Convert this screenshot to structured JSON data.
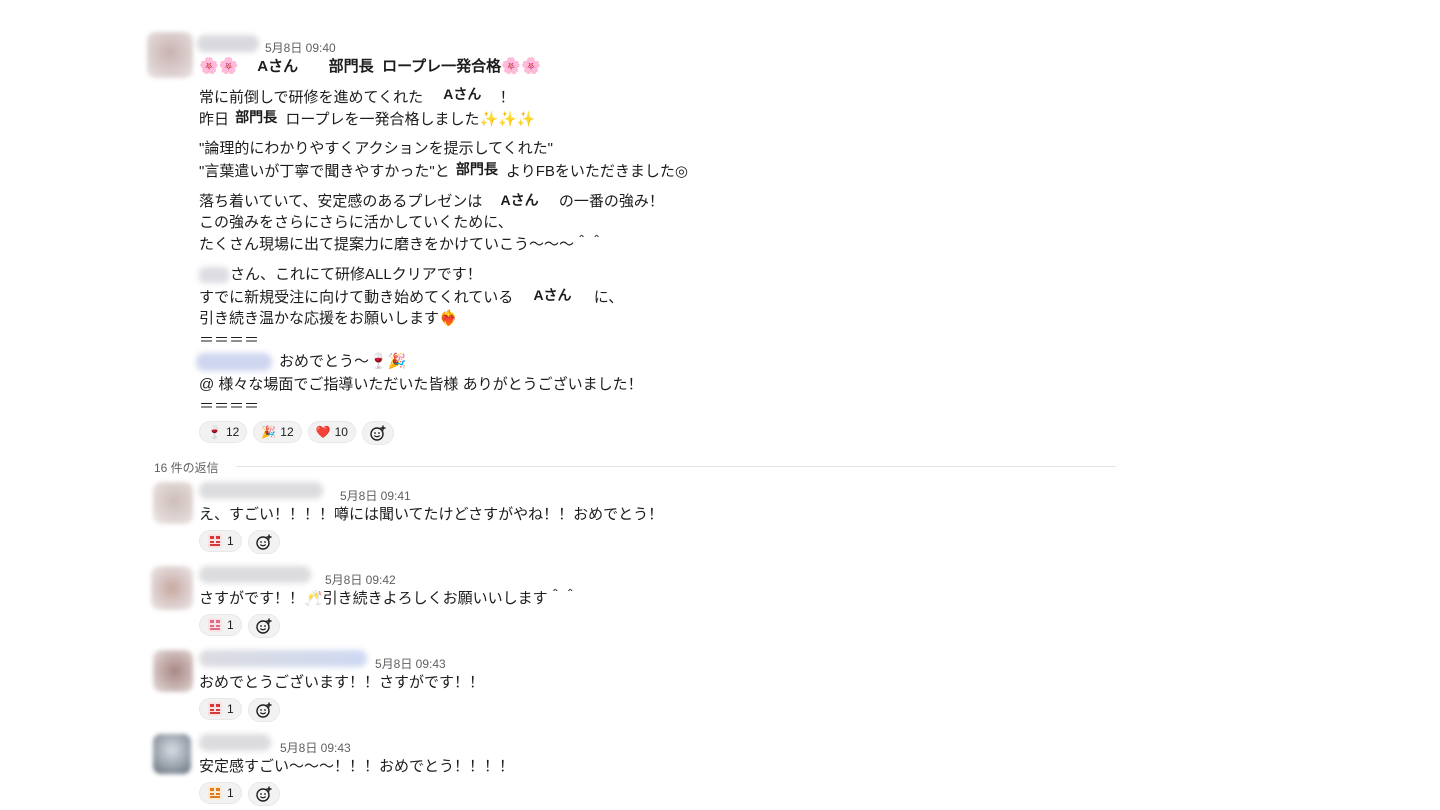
{
  "message": {
    "timestamp": "5月8日 09:40",
    "title_parts": [
      "🌸🌸",
      "Aさん",
      "部門長",
      "ロープレ一発合格",
      "🌸🌸"
    ],
    "lines": {
      "l1a": "常に前倒しで研修を進めてくれた",
      "l1b": "Aさん",
      "l1c": "！",
      "l2a": "昨日",
      "l2b": "部門長",
      "l2c": "ロープレを一発合格しました✨✨✨",
      "l3": "\"論理的にわかりやすくアクションを提示してくれた\"",
      "l4a": "\"言葉遣いが丁寧で聞きやすかった\"と",
      "l4b": "部門長",
      "l4c": "よりFBをいただきました◎",
      "l5a": "落ち着いていて、安定感のあるプレゼンは",
      "l5b": "Aさん",
      "l5c": "の一番の強み！",
      "l6": "この強みをさらにさらに活かしていくために、",
      "l7": "たくさん現場に出て提案力に磨きをかけていこう〜〜〜＾＾",
      "l8": "さん、これにて研修ALLクリアです！",
      "l9a": "すでに新規受注に向けて動き始めてくれている",
      "l9b": "Aさん",
      "l9c": "に、",
      "l10": "引き続き温かな応援をお願いします❤️‍🔥",
      "l11": "＝＝＝＝",
      "l12": "おめでとう〜🍷🎉",
      "l13": "@ 様々な場面でご指導いただいた皆様 ありがとうございました！",
      "l14": "＝＝＝＝"
    },
    "reactions": [
      {
        "emoji": "🍷",
        "count": "12"
      },
      {
        "emoji": "🎉",
        "count": "12"
      },
      {
        "emoji": "❤️",
        "count": "10"
      }
    ]
  },
  "thread": {
    "reply_count_label": "16 件の返信",
    "replies": [
      {
        "timestamp": "5月8日 09:41",
        "text": "え、すごい！！！！噂には聞いてたけどさすがやね！！おめでとう！",
        "reaction_count": "1"
      },
      {
        "timestamp": "5月8日 09:42",
        "text": "さすがです！！🥂引き続きよろしくお願いいします＾＾",
        "reaction_count": "1"
      },
      {
        "timestamp": "5月8日 09:43",
        "text": "おめでとうございます！！さすがです！！",
        "reaction_count": "1"
      },
      {
        "timestamp": "5月8日 09:43",
        "text": "安定感すごい〜〜〜！！！おめでとう！！！！",
        "reaction_count": "1"
      }
    ]
  },
  "icons": {
    "add_reaction": "add-reaction-icon",
    "custom_emoji": "custom-emoji-icon"
  },
  "colors": {
    "text": "#1d1c1d",
    "muted": "#616061",
    "pill_bg": "#f2f2f2"
  }
}
